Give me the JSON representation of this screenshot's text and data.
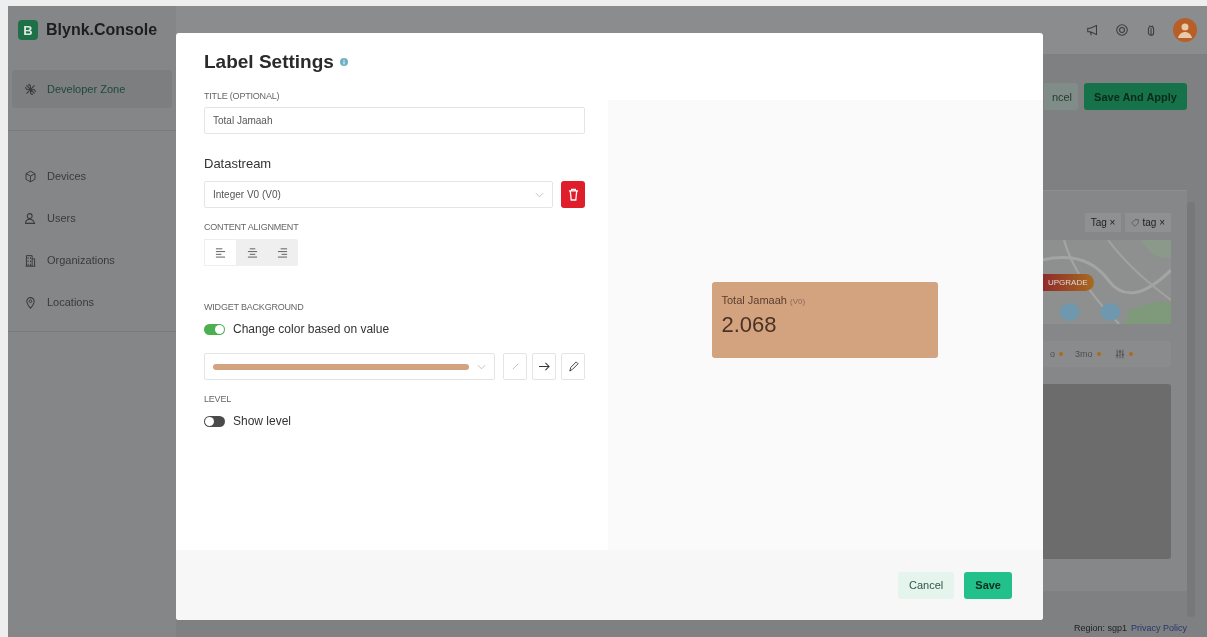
{
  "app": {
    "logo_letter": "B",
    "name": "Blynk.Console"
  },
  "sidebar": {
    "items": [
      {
        "label": "Developer Zone",
        "selected": true
      },
      {
        "label": "Devices",
        "selected": false
      },
      {
        "label": "Users",
        "selected": false
      },
      {
        "label": "Organizations",
        "selected": false
      },
      {
        "label": "Locations",
        "selected": false
      }
    ]
  },
  "page_actions": [
    {
      "label": "ncel",
      "kind": "secondary"
    },
    {
      "label": "Save And Apply",
      "kind": "primary"
    }
  ],
  "tags": [
    {
      "label": "Tag",
      "close": "×",
      "kind": "plain"
    },
    {
      "label": "tag",
      "close": "×",
      "kind": "tagged"
    }
  ],
  "map": {
    "badge": "UPGRADE"
  },
  "ranges": [
    {
      "kind": "text",
      "label": "o"
    },
    {
      "kind": "text",
      "label": "3mo"
    },
    {
      "kind": "filter"
    }
  ],
  "footer": {
    "region": "Region: sgp1",
    "link": "Privacy Policy"
  },
  "modal": {
    "title": "Label Settings",
    "title_field": {
      "label": "TITLE (OPTIONAL)",
      "value": "Total Jamaah"
    },
    "datastream": {
      "heading": "Datastream",
      "value": "Integer V0 (V0)"
    },
    "alignment": {
      "label": "CONTENT ALIGNMENT",
      "options": [
        {
          "kind": "left",
          "selected": true
        },
        {
          "kind": "center",
          "selected": false
        },
        {
          "kind": "right",
          "selected": false
        }
      ]
    },
    "background": {
      "label": "WIDGET BACKGROUND",
      "toggle": {
        "label": "Change color based on value",
        "on": true
      },
      "color": "#d3a27f"
    },
    "level": {
      "label": "LEVEL",
      "toggle": {
        "label": "Show level",
        "on": false
      }
    },
    "preview": {
      "title": "Total Jamaah",
      "pin": "(V0)",
      "value": "2.068"
    },
    "buttons": [
      {
        "label": "Cancel",
        "kind": "secondary"
      },
      {
        "label": "Save",
        "kind": "primary"
      }
    ]
  }
}
